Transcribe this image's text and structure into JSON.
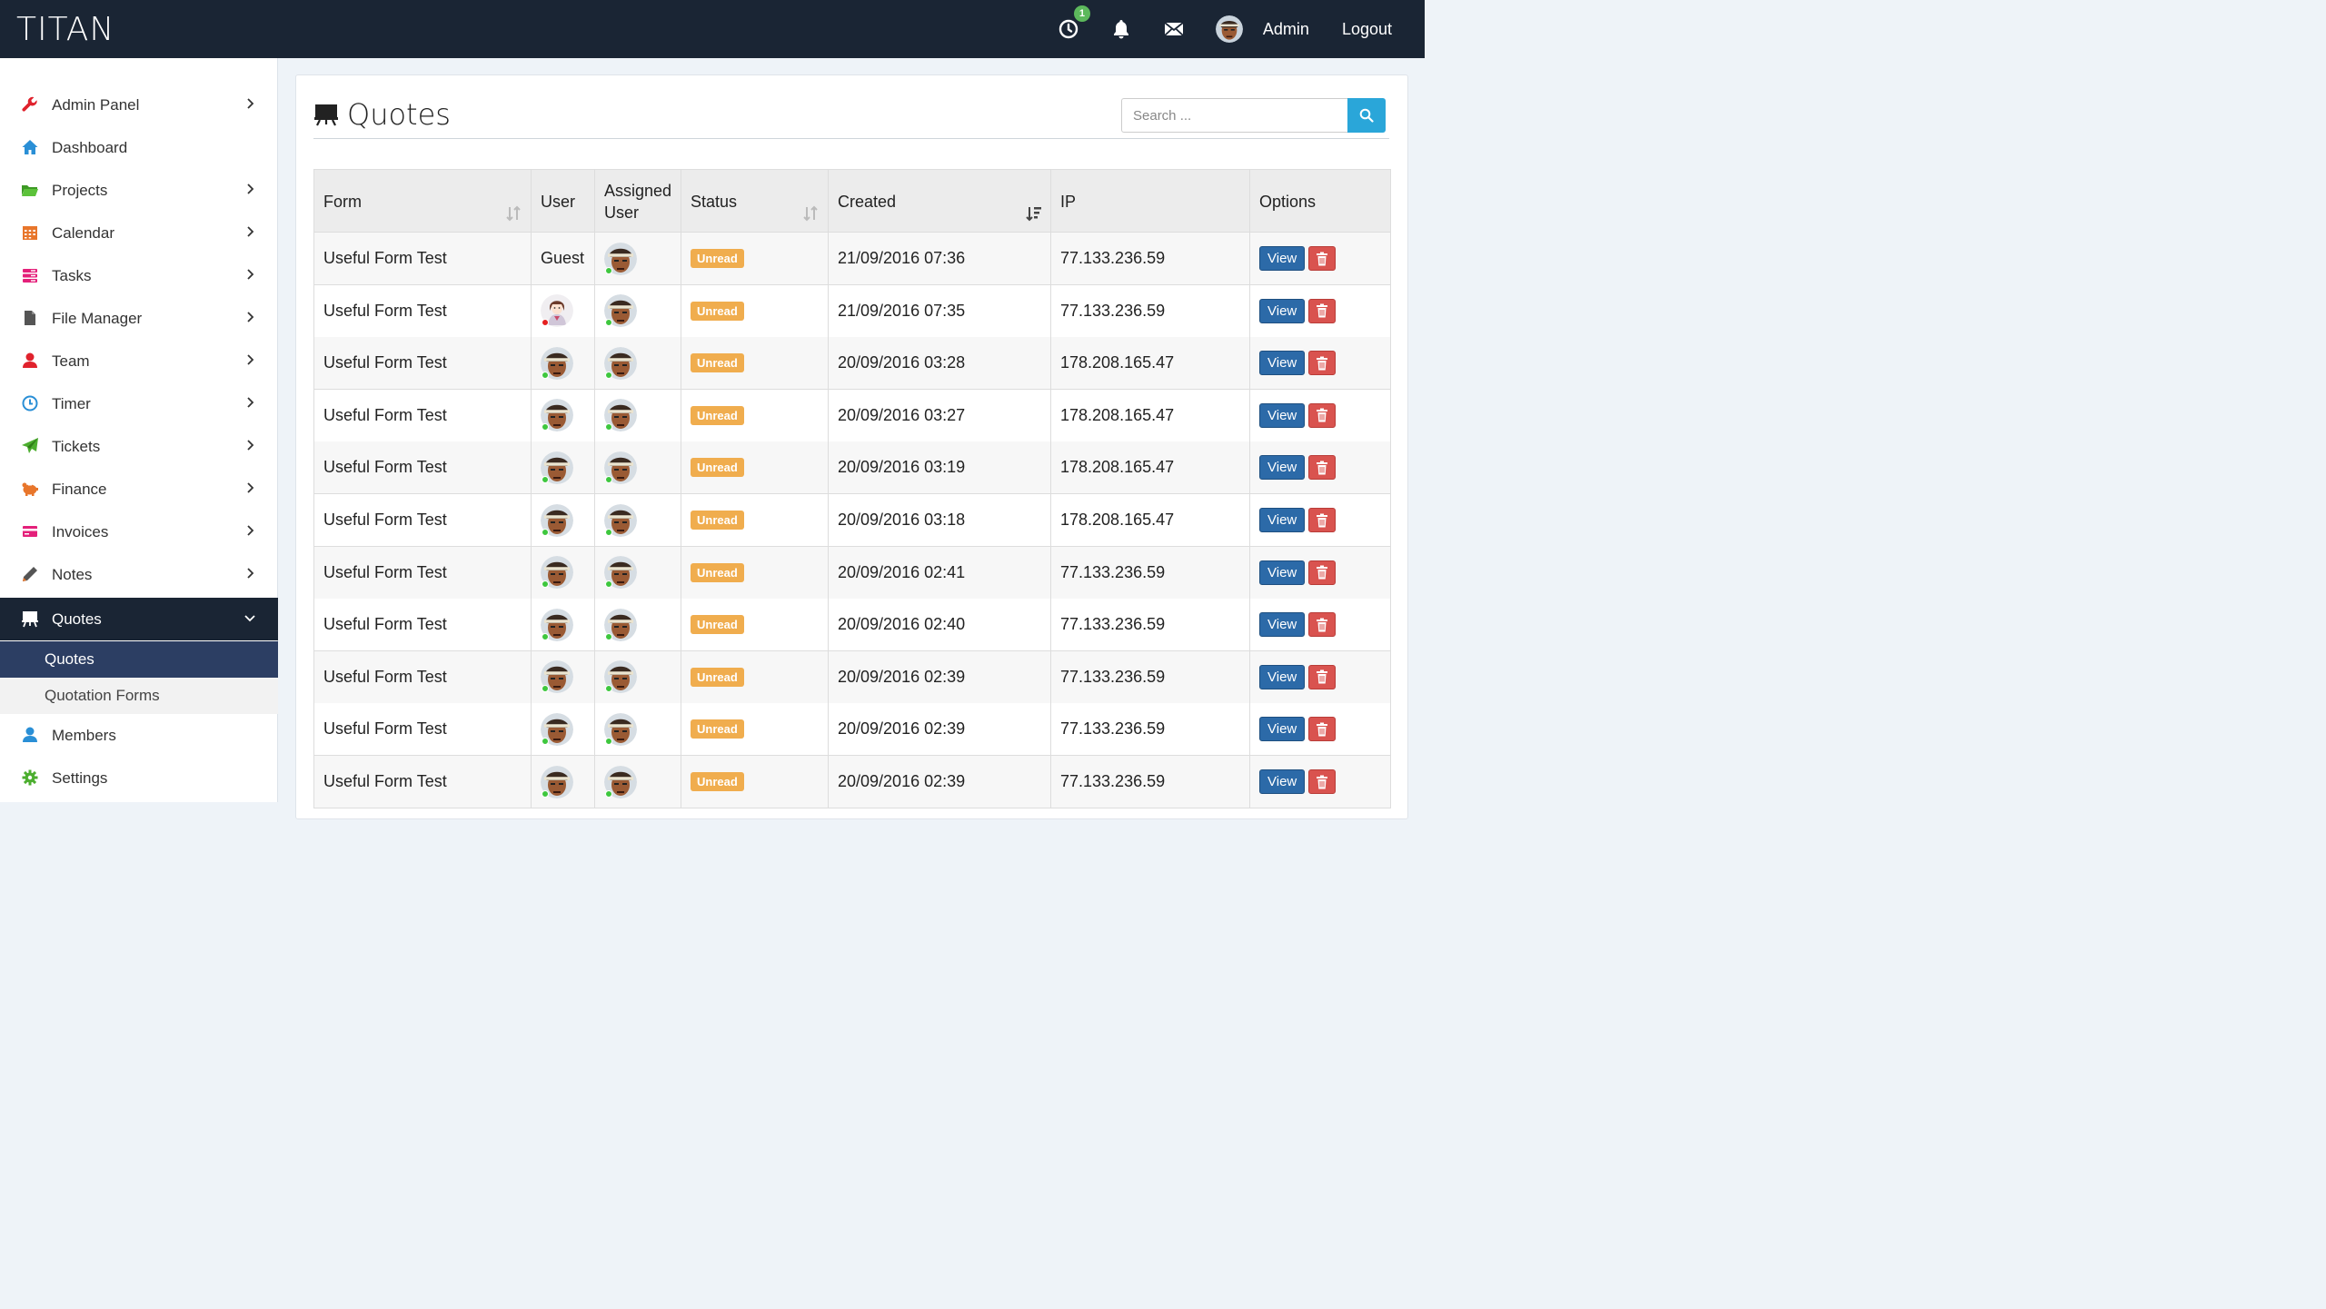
{
  "app": {
    "brand": "TITAN"
  },
  "topbar": {
    "history_badge": "1",
    "user_name": "Admin",
    "logout_label": "Logout",
    "icons": [
      "clock-icon",
      "bell-icon",
      "envelope-icon",
      "avatar"
    ]
  },
  "sidebar": {
    "items": [
      {
        "label": "Admin Panel",
        "icon": "wrench-icon",
        "color": "#e0222d",
        "has_children": true
      },
      {
        "label": "Dashboard",
        "icon": "home-icon",
        "color": "#2a8fd6",
        "has_children": false
      },
      {
        "label": "Projects",
        "icon": "folder-icon",
        "color": "#4cae2f",
        "has_children": true
      },
      {
        "label": "Calendar",
        "icon": "calendar-icon",
        "color": "#e8762b",
        "has_children": true
      },
      {
        "label": "Tasks",
        "icon": "tasks-icon",
        "color": "#e4207a",
        "has_children": true
      },
      {
        "label": "File Manager",
        "icon": "file-icon",
        "color": "#555555",
        "has_children": true
      },
      {
        "label": "Team",
        "icon": "user-icon",
        "color": "#e0222d",
        "has_children": true
      },
      {
        "label": "Timer",
        "icon": "clock-icon",
        "color": "#2a8fd6",
        "has_children": true
      },
      {
        "label": "Tickets",
        "icon": "paper-plane-icon",
        "color": "#4cae2f",
        "has_children": true
      },
      {
        "label": "Finance",
        "icon": "piggy-bank-icon",
        "color": "#e8762b",
        "has_children": true
      },
      {
        "label": "Invoices",
        "icon": "credit-card-icon",
        "color": "#e4207a",
        "has_children": true
      },
      {
        "label": "Notes",
        "icon": "pencil-icon",
        "color": "#555555",
        "has_children": true
      },
      {
        "label": "Quotes",
        "icon": "easel-icon",
        "color": "#ffffff",
        "has_children": true,
        "active": true
      },
      {
        "label": "Members",
        "icon": "user-icon",
        "color": "#2a8fd6",
        "has_children": false
      },
      {
        "label": "Settings",
        "icon": "gear-icon",
        "color": "#4cae2f",
        "has_children": false
      }
    ],
    "quotes_sub": [
      {
        "label": "Quotes",
        "selected": true
      },
      {
        "label": "Quotation Forms",
        "selected": false
      }
    ]
  },
  "main": {
    "title": "Quotes",
    "search_placeholder": "Search ...",
    "columns": [
      "Form",
      "User",
      "Assigned User",
      "Status",
      "Created",
      "IP",
      "Options"
    ],
    "view_label": "View",
    "rows": [
      {
        "form": "Useful Form Test",
        "user": "Guest",
        "user_avatar": null,
        "status": "Unread",
        "created": "21/09/2016 07:36",
        "ip": "77.133.236.59"
      },
      {
        "form": "Useful Form Test",
        "user": "",
        "user_avatar": "female-avatar",
        "status": "Unread",
        "created": "21/09/2016 07:35",
        "ip": "77.133.236.59"
      },
      {
        "form": "Useful Form Test",
        "user": "",
        "user_avatar": "male-avatar",
        "status": "Unread",
        "created": "20/09/2016 03:28",
        "ip": "178.208.165.47"
      },
      {
        "form": "Useful Form Test",
        "user": "",
        "user_avatar": "male-avatar",
        "status": "Unread",
        "created": "20/09/2016 03:27",
        "ip": "178.208.165.47"
      },
      {
        "form": "Useful Form Test",
        "user": "",
        "user_avatar": "male-avatar",
        "status": "Unread",
        "created": "20/09/2016 03:19",
        "ip": "178.208.165.47"
      },
      {
        "form": "Useful Form Test",
        "user": "",
        "user_avatar": "male-avatar",
        "status": "Unread",
        "created": "20/09/2016 03:18",
        "ip": "178.208.165.47"
      },
      {
        "form": "Useful Form Test",
        "user": "",
        "user_avatar": "male-avatar",
        "status": "Unread",
        "created": "20/09/2016 02:41",
        "ip": "77.133.236.59"
      },
      {
        "form": "Useful Form Test",
        "user": "",
        "user_avatar": "male-avatar",
        "status": "Unread",
        "created": "20/09/2016 02:40",
        "ip": "77.133.236.59"
      },
      {
        "form": "Useful Form Test",
        "user": "",
        "user_avatar": "male-avatar",
        "status": "Unread",
        "created": "20/09/2016 02:39",
        "ip": "77.133.236.59"
      },
      {
        "form": "Useful Form Test",
        "user": "",
        "user_avatar": "male-avatar",
        "status": "Unread",
        "created": "20/09/2016 02:39",
        "ip": "77.133.236.59"
      },
      {
        "form": "Useful Form Test",
        "user": "",
        "user_avatar": "male-avatar",
        "status": "Unread",
        "created": "20/09/2016 02:39",
        "ip": "77.133.236.59"
      }
    ]
  },
  "colors": {
    "topbar_bg": "#1a2534",
    "status_unread": "#f0ad4e",
    "view_button": "#2c6aa8",
    "delete_button": "#d9534f",
    "search_button": "#2aa6d9",
    "online": "#3ec73e",
    "offline": "#e52020"
  }
}
